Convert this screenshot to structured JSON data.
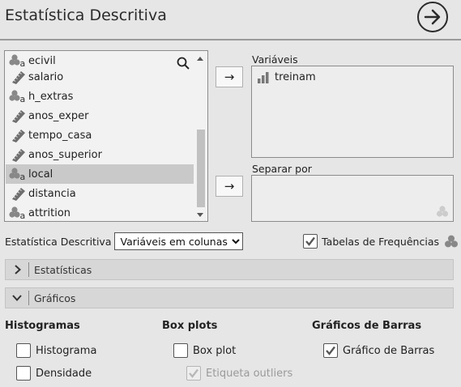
{
  "header": {
    "title": "Estatística Descritiva",
    "run_icon": "arrow-right-circle-icon"
  },
  "variables": [
    {
      "label": "ecivil",
      "type": "nominal"
    },
    {
      "label": "salario",
      "type": "scale"
    },
    {
      "label": "h_extras",
      "type": "nominal"
    },
    {
      "label": "anos_exper",
      "type": "scale"
    },
    {
      "label": "tempo_casa",
      "type": "scale"
    },
    {
      "label": "anos_superior",
      "type": "scale"
    },
    {
      "label": "local",
      "type": "nominal",
      "selected": true
    },
    {
      "label": "distancia",
      "type": "scale"
    },
    {
      "label": "attrition",
      "type": "nominal"
    }
  ],
  "targets": {
    "variaveis_label": "Variáveis",
    "variaveis_items": [
      {
        "label": "treinam",
        "type": "ordinal"
      }
    ],
    "separar_label": "Separar por",
    "move_icon": "→"
  },
  "options": {
    "layout_label": "Estatística Descritiva",
    "layout_select": "Variáveis em colunas",
    "freq_label": "Tabelas de Frequências",
    "freq_checked": true
  },
  "sections": {
    "estatisticas": "Estatísticas",
    "graficos": "Gráficos"
  },
  "graficos": {
    "histogramas": {
      "heading": "Histogramas",
      "items": [
        {
          "label": "Histograma",
          "checked": false
        },
        {
          "label": "Densidade",
          "checked": false
        }
      ]
    },
    "boxplots": {
      "heading": "Box plots",
      "items": [
        {
          "label": "Box plot",
          "checked": false
        },
        {
          "label": "Etiqueta outliers",
          "checked": true,
          "disabled": true
        }
      ]
    },
    "barras": {
      "heading": "Gráficos de Barras",
      "items": [
        {
          "label": "Gráfico de Barras",
          "checked": true
        }
      ]
    }
  },
  "colors": {
    "background": "#e6e6e6",
    "selected_row": "#c9c9c9",
    "section_bar": "#d7d7d7"
  }
}
